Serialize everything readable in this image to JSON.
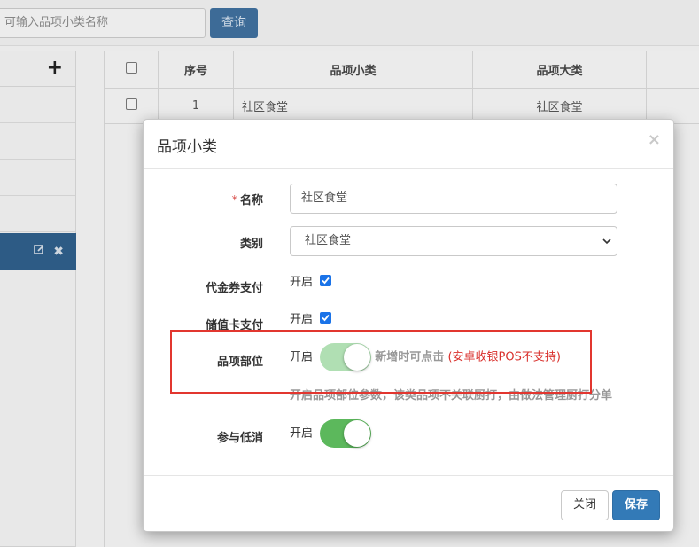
{
  "search": {
    "placeholder": "可输入品项小类名称",
    "button": "查询"
  },
  "tree": {
    "add_icon": "plus-icon",
    "selected_actions": [
      "edit-icon",
      "delete-icon"
    ]
  },
  "table": {
    "headers": [
      "序号",
      "品项小类",
      "品项大类"
    ],
    "rows": [
      {
        "index": "1",
        "subcategory": "社区食堂",
        "category": "社区食堂"
      }
    ]
  },
  "modal": {
    "title": "品项小类",
    "close_icon": "close-icon",
    "fields": {
      "name": {
        "required_mark": "*",
        "label": "名称",
        "value": "社区食堂"
      },
      "category": {
        "label": "类别",
        "selected": "社区食堂"
      },
      "voucher_pay": {
        "label": "代金券支付",
        "option": "开启",
        "checked": true
      },
      "card_pay": {
        "label": "储值卡支付",
        "option": "开启",
        "checked": true
      },
      "location": {
        "label": "品项部位",
        "option": "开启",
        "on": true,
        "disabled": true,
        "hint": "新增时可点击",
        "hint_red": "(安卓收银POS不支持)",
        "help": "开启品项部位参数，该类品项不关联厨打，由做法管理厨打分单"
      },
      "low_consumption": {
        "label": "参与低消",
        "option": "开启",
        "on": true
      }
    },
    "buttons": {
      "close": "关闭",
      "save": "保存"
    }
  },
  "colors": {
    "primary": "#337ab7",
    "switch_on": "#5cb85c",
    "highlight": "#e2362f",
    "required": "#d9534f"
  }
}
